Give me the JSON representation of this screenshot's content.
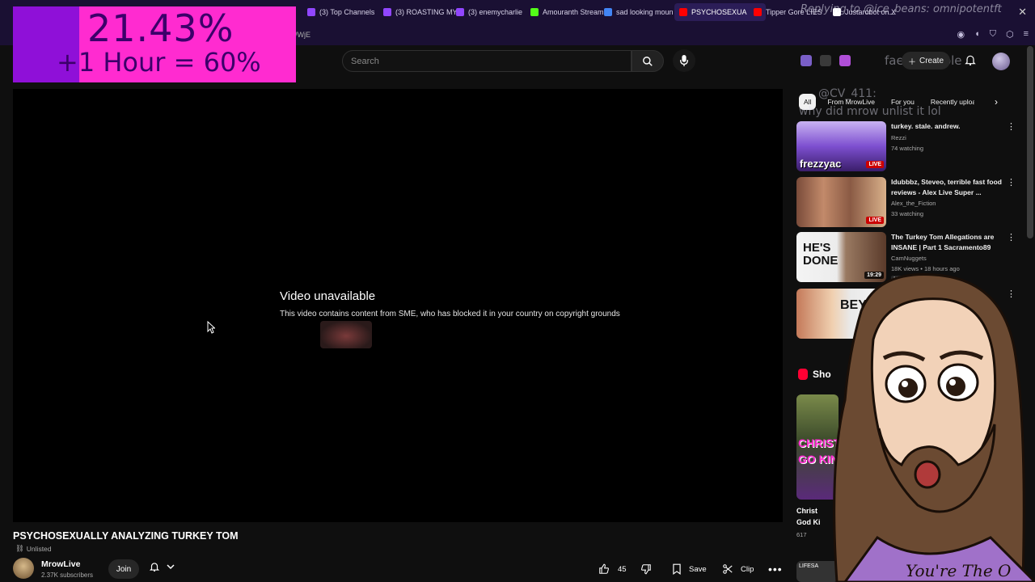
{
  "browser": {
    "tabs": [
      {
        "label": "(3) Top Channels",
        "color": "#9146ff"
      },
      {
        "label": "(3) ROASTING MY",
        "color": "#9146ff"
      },
      {
        "label": "(3) enemycharlie",
        "color": "#9146ff"
      },
      {
        "label": "Amouranth Stream",
        "color": "#53fc18"
      },
      {
        "label": "sad looking moun",
        "color": "#4285f4"
      },
      {
        "label": "PSYCHOSEXUA",
        "color": "#ff0000"
      },
      {
        "label": "Tipper Gore LIES",
        "color": "#ff0000"
      },
      {
        "label": "Justarobot on X",
        "color": "#ffffff"
      }
    ],
    "url_fragment": "/WjE"
  },
  "overlay": {
    "percent": "21.43%",
    "subtext": "+1 Hour = 60%",
    "colors": {
      "outer": "#8f10d8",
      "inner": "#ff2bd0",
      "text": "#3c006a"
    }
  },
  "twitch_chat": {
    "reply": "Replying to @ice_beans: omnipotentft",
    "handle": "faerieBubble",
    "message_user": "@CV_411:",
    "message_text": "why did mrow unlist it lol"
  },
  "header": {
    "search_placeholder": "Search",
    "create_label": "Create"
  },
  "player": {
    "unavailable_title": "Video unavailable",
    "unavailable_message": "This video contains content from SME, who has blocked it in your country on copyright grounds"
  },
  "video": {
    "title": "PSYCHOSEXUALLY ANALYZING TURKEY TOM",
    "visibility": "Unlisted",
    "channel": "MrowLive",
    "subscribers": "2.37K subscribers",
    "join_label": "Join",
    "likes": "45",
    "save_label": "Save",
    "clip_label": "Clip"
  },
  "sidebar": {
    "chips": [
      "All",
      "From MrowLive",
      "For you",
      "Recently uploaded"
    ],
    "recommendations": [
      {
        "title": "turkey. stale. andrew.",
        "channel": "Rezzi",
        "stats": "74 watching",
        "badge": "LIVE",
        "thumb_text": "frezzyac"
      },
      {
        "title": "Idubbbz, Steveo, terrible fast food reviews - Alex Live Super ...",
        "channel": "Alex_the_Fiction",
        "stats": "33 watching",
        "badge": "LIVE",
        "thumb_text": ""
      },
      {
        "title": "The Turkey Tom Allegations are INSANE | Part 1 Sacramento89",
        "channel": "CamNuggets",
        "stats": "18K views • 18 hours ago",
        "badge": "19:29",
        "thumb_text": "HE'S DONE",
        "tag": "New"
      },
      {
        "title": "",
        "channel": "",
        "stats": "",
        "badge": "",
        "thumb_text": "BEYO"
      }
    ],
    "shorts_heading": "Sho",
    "short": {
      "title_line1": "Christ",
      "title_line2": "God Ki",
      "views": "617",
      "thumb_text": "CHRIST GO KIN"
    },
    "short2_text": "LIFESA"
  },
  "figure_text": "You're The O"
}
